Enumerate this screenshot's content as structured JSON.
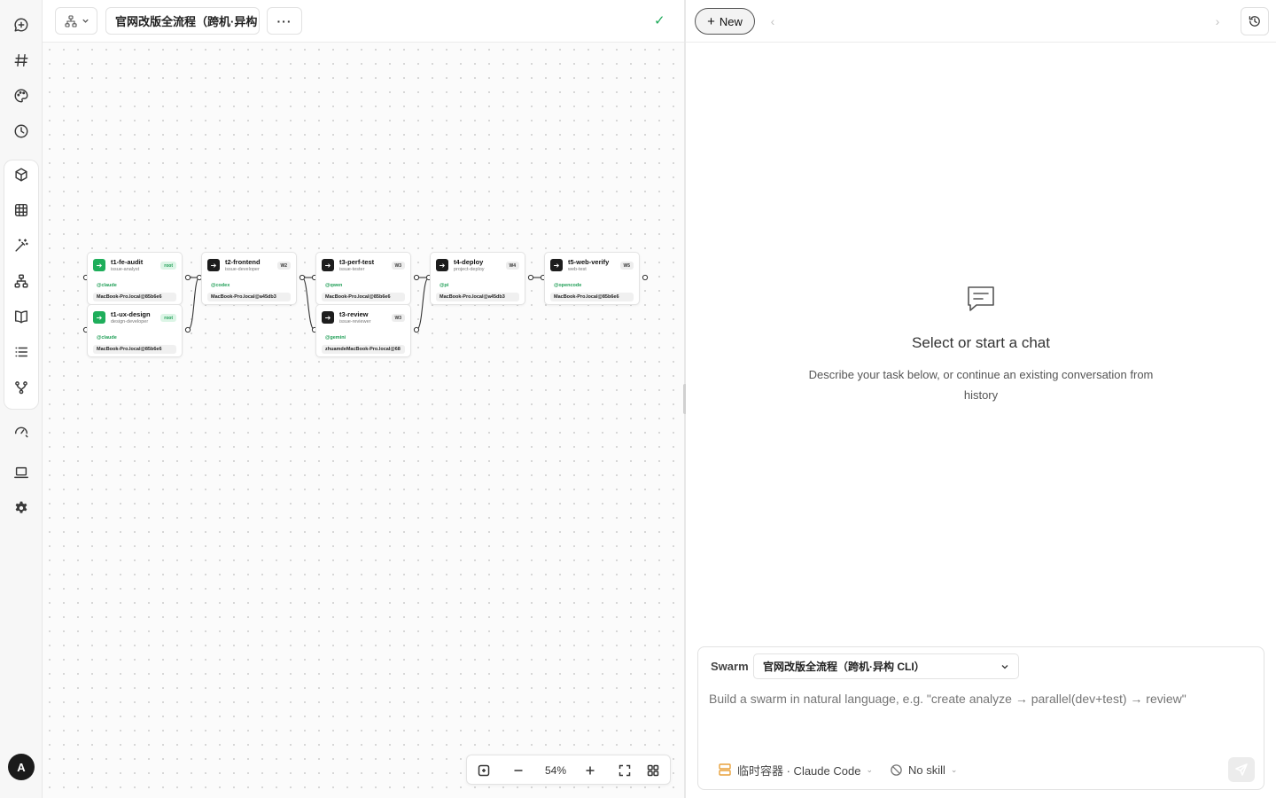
{
  "rail": {
    "items": [
      "new-chat-icon",
      "hash-icon",
      "palette-icon",
      "history-clock-icon",
      "cube-icon",
      "grid-icon",
      "magic-wand-icon",
      "workflow-icon",
      "book-icon",
      "list-icon",
      "branch-icon",
      "gauge-icon",
      "laptop-icon",
      "settings-icon"
    ],
    "avatar": "A"
  },
  "canvas": {
    "title": "官网改版全流程（跨机·异构",
    "more": "···",
    "status": "✓",
    "zoom": "54%",
    "nodes": [
      {
        "title": "t1-fe-audit",
        "role": "issue-analyst",
        "badge": "root",
        "agent": "@claude",
        "host": "MacBook-Pro.local@85b6e6"
      },
      {
        "title": "t1-ux-design",
        "role": "design-developer",
        "badge": "root",
        "agent": "@claude",
        "host": "MacBook-Pro.local@85b6e6"
      },
      {
        "title": "t2-frontend",
        "role": "issue-developer",
        "badge": "W2",
        "agent": "@codex",
        "host": "MacBook-Pro.local@a45db3"
      },
      {
        "title": "t3-perf-test",
        "role": "issue-tester",
        "badge": "W3",
        "agent": "@qwen",
        "host": "MacBook-Pro.local@85b6e6"
      },
      {
        "title": "t3-review",
        "role": "issue-reviewer",
        "badge": "W3",
        "agent": "@gemini",
        "host": "zhuamdeMacBook-Pro.local@68"
      },
      {
        "title": "t4-deploy",
        "role": "project-deploy",
        "badge": "W4",
        "agent": "@pi",
        "host": "MacBook-Pro.local@a45db3"
      },
      {
        "title": "t5-web-verify",
        "role": "web-test",
        "badge": "W5",
        "agent": "@opencode",
        "host": "MacBook-Pro.local@85b6e6"
      }
    ]
  },
  "chat": {
    "new_label": "New",
    "prev": "‹",
    "next": "›",
    "empty_title": "Select or start a chat",
    "empty_desc": "Describe your task below, or continue an existing conversation from history",
    "swarm_label": "Swarm",
    "swarm_value": "官网改版全流程（跨机·异构 CLI）",
    "prompt_placeholder": "Build a swarm in natural language, e.g. \"create analyze → parallel(dev+test) → review\"",
    "runtime": "临时容器 · Claude Code",
    "skill": "No skill"
  },
  "colors": {
    "accent_green": "#1fae5b",
    "runtime_orange": "#e8a13a"
  }
}
